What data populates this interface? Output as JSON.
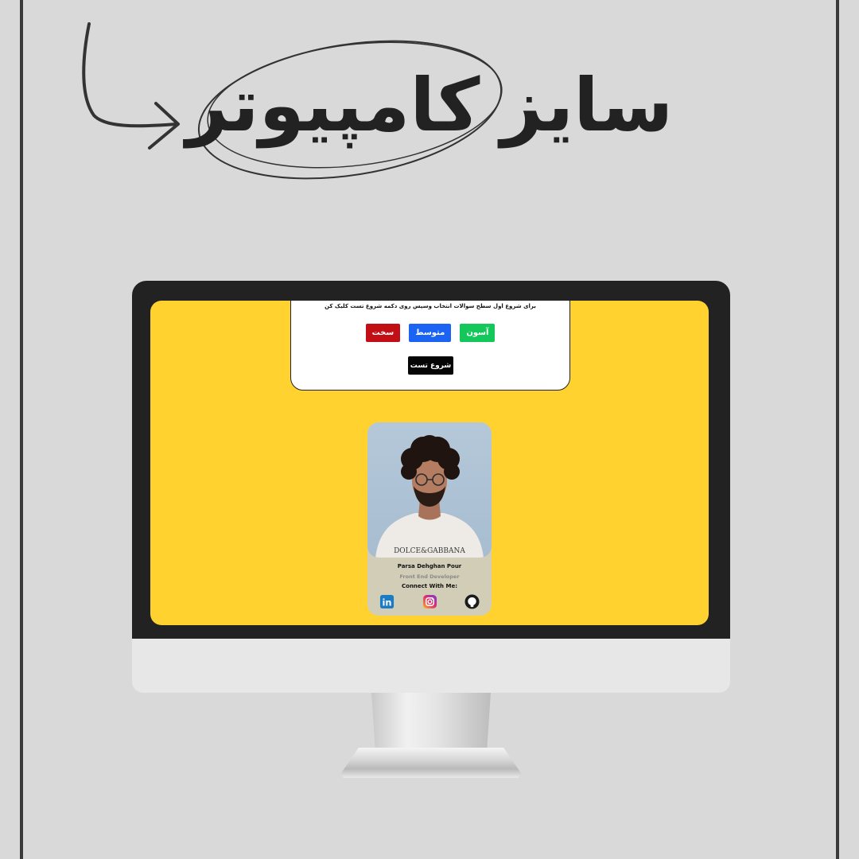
{
  "header": {
    "word_size": "سایز",
    "word_computer": "کامپیوتر"
  },
  "quiz": {
    "instruction": "برای شروع اول سطح سوالات انتخاب وسپس روی دکمه شروع تست کلیک کن",
    "levels": [
      {
        "label": "آسون",
        "color": "#13c75b"
      },
      {
        "label": "متوسط",
        "color": "#1a63f3"
      },
      {
        "label": "سخت",
        "color": "#c20f16"
      }
    ],
    "start_label": "شروع تست"
  },
  "profile": {
    "name": "Parsa Dehghan Pour",
    "role": "Front End Developer",
    "connect": "Connect With Me:",
    "shirt_text": "DOLCE&GABBANA",
    "socials": [
      "linkedin-icon",
      "instagram-icon",
      "github-icon"
    ],
    "linkedin_text": "in"
  },
  "colors": {
    "background": "#d9d9d9",
    "screen": "#ffd22f",
    "bezel": "#222222",
    "card": "#d2cdb7"
  }
}
